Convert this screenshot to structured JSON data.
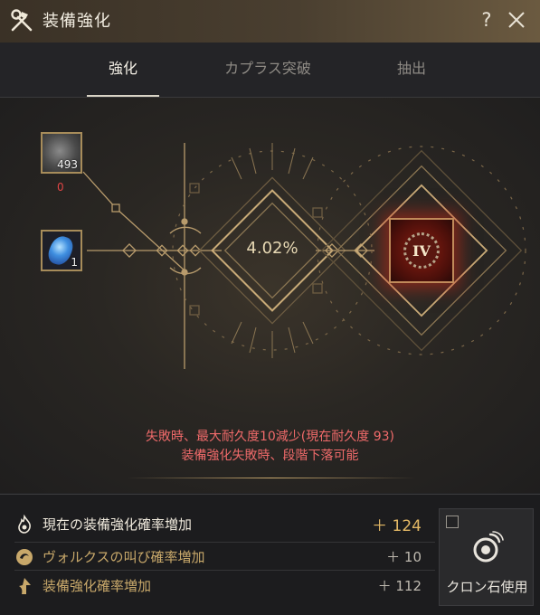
{
  "window": {
    "title": "装備強化"
  },
  "tabs": [
    {
      "label": "強化",
      "active": true
    },
    {
      "label": "カプラス突破",
      "active": false
    },
    {
      "label": "抽出",
      "active": false
    }
  ],
  "materials": {
    "stone": {
      "count": "493",
      "required": "0"
    },
    "crystal": {
      "count": "1"
    }
  },
  "success_rate": "4.02%",
  "result_item": {
    "grade": "IV"
  },
  "warnings": {
    "line1": "失敗時、最大耐久度10減少(現在耐久度 93)",
    "line2": "装備強化失敗時、段階下落可能"
  },
  "stats": [
    {
      "label": "現在の装備強化確率増加",
      "value": "＋ 124"
    },
    {
      "label": "ヴォルクスの叫び確率増加",
      "value": "＋ 10"
    },
    {
      "label": "装備強化確率増加",
      "value": "＋ 112"
    }
  ],
  "kron": {
    "label": "クロン石使用",
    "checked": false
  },
  "colors": {
    "accent_gold": "#e3b865",
    "warning_red": "#ef6a6a",
    "frame_gold": "#a78c5a"
  }
}
